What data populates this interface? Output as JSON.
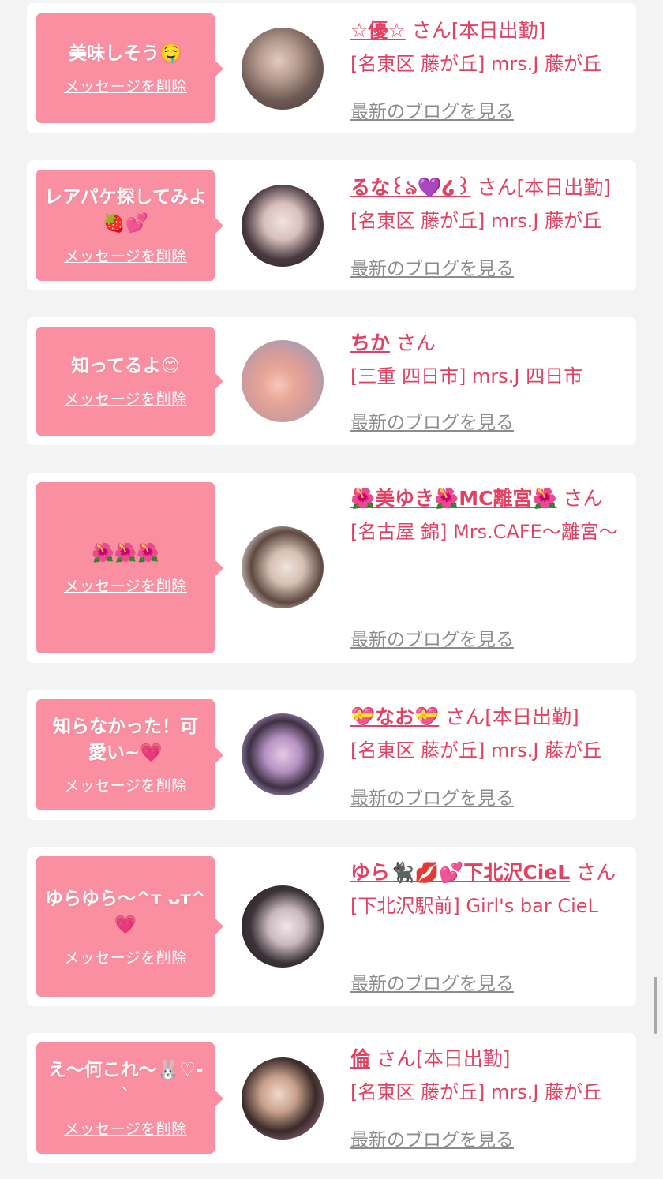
{
  "theme": {
    "accent": "#e83f61",
    "bubble_bg": "#fa8fa1",
    "page_bg": "#f3f3f3",
    "card_bg": "#ffffff",
    "blog_link_color": "#8c8c8c"
  },
  "items": [
    {
      "message": "美味しそう🤤",
      "delete_label": "メッセージを削除",
      "name": "☆優☆",
      "san": " さん",
      "status": "[本日出勤]",
      "store": "[名東区 藤が丘] mrs.J 藤が丘",
      "blog_label": "最新のブログを見る",
      "avatar": "avatar-photo"
    },
    {
      "message": "レアパケ探してみよ🍓💕",
      "delete_label": "メッセージを削除",
      "name": "るな꒰ঌ💜໒꒱",
      "san": " さん",
      "status": "[本日出勤]",
      "store": "[名東区 藤が丘] mrs.J 藤が丘",
      "blog_label": "最新のブログを見る",
      "avatar": "avatar-photo"
    },
    {
      "message": "知ってるよ😊",
      "delete_label": "メッセージを削除",
      "name": "ちか",
      "san": " さん",
      "status": "",
      "store": "[三重 四日市] mrs.J 四日市",
      "blog_label": "最新のブログを見る",
      "avatar": "avatar-photo"
    },
    {
      "message": "🌺🌺🌺",
      "delete_label": "メッセージを削除",
      "name": "🌺美ゆき🌺MC離宮🌺",
      "san": " さん",
      "status": "",
      "store": "[名古屋 錦] Mrs.CAFE～離宮～",
      "blog_label": "最新のブログを見る",
      "avatar": "avatar-photo"
    },
    {
      "message": "知らなかった！可愛い~💗",
      "delete_label": "メッセージを削除",
      "name": "💝なお💝",
      "san": " さん",
      "status": "[本日出勤]",
      "store": "[名東区 藤が丘] mrs.J 藤が丘",
      "blog_label": "最新のブログを見る",
      "avatar": "avatar-photo"
    },
    {
      "message": "ゆらゆら〜^ᴛ ᴗᴛ^💗",
      "delete_label": "メッセージを削除",
      "name": "ゆら🐈‍⬛💋💕下北沢CieL",
      "san": " さん",
      "status": "",
      "store": "[下北沢駅前] Girl's bar CieL",
      "blog_label": "最新のブログを見る",
      "avatar": "avatar-photo"
    },
    {
      "message": "え〜何これ〜🐰♡-`",
      "delete_label": "メッセージを削除",
      "name": "倫",
      "san": " さん",
      "status": "[本日出勤]",
      "store": "[名東区 藤が丘] mrs.J 藤が丘",
      "blog_label": "最新のブログを見る",
      "avatar": "avatar-photo"
    }
  ]
}
